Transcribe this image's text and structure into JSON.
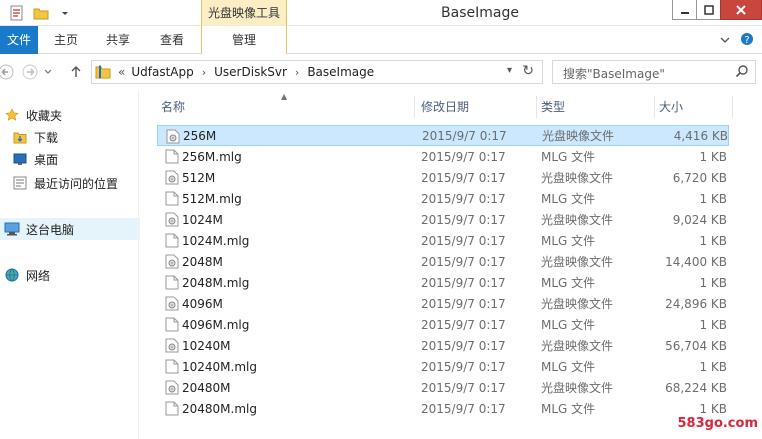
{
  "window": {
    "title": "BaseImage",
    "context_tab_group": "光盘映像工具"
  },
  "ribbon": {
    "tabs": [
      {
        "label": "文件"
      },
      {
        "label": "主页"
      },
      {
        "label": "共享"
      },
      {
        "label": "查看"
      },
      {
        "label": "管理"
      }
    ]
  },
  "address": {
    "overflow": "«",
    "crumbs": [
      "UdfastApp",
      "UserDiskSvr",
      "BaseImage"
    ]
  },
  "search": {
    "placeholder": "搜索\"BaseImage\""
  },
  "navpane": {
    "items": [
      {
        "label": "收藏夹",
        "icon": "star-icon"
      },
      {
        "label": "下载",
        "icon": "downloads-folder-icon"
      },
      {
        "label": "桌面",
        "icon": "desktop-icon"
      },
      {
        "label": "最近访问的位置",
        "icon": "recent-places-icon"
      },
      {
        "label": "这台电脑",
        "icon": "computer-icon"
      },
      {
        "label": "网络",
        "icon": "network-icon"
      }
    ]
  },
  "columns": {
    "name": "名称",
    "date": "修改日期",
    "type": "类型",
    "size": "大小"
  },
  "files": [
    {
      "name": "256M",
      "date": "2015/9/7 0:17",
      "type": "光盘映像文件",
      "size": "4,416 KB",
      "selected": true
    },
    {
      "name": "256M.mlg",
      "date": "2015/9/7 0:17",
      "type": "MLG 文件",
      "size": "1 KB"
    },
    {
      "name": "512M",
      "date": "2015/9/7 0:17",
      "type": "光盘映像文件",
      "size": "6,720 KB"
    },
    {
      "name": "512M.mlg",
      "date": "2015/9/7 0:17",
      "type": "MLG 文件",
      "size": "1 KB"
    },
    {
      "name": "1024M",
      "date": "2015/9/7 0:17",
      "type": "光盘映像文件",
      "size": "9,024 KB"
    },
    {
      "name": "1024M.mlg",
      "date": "2015/9/7 0:17",
      "type": "MLG 文件",
      "size": "1 KB"
    },
    {
      "name": "2048M",
      "date": "2015/9/7 0:17",
      "type": "光盘映像文件",
      "size": "14,400 KB"
    },
    {
      "name": "2048M.mlg",
      "date": "2015/9/7 0:17",
      "type": "MLG 文件",
      "size": "1 KB"
    },
    {
      "name": "4096M",
      "date": "2015/9/7 0:17",
      "type": "光盘映像文件",
      "size": "24,896 KB"
    },
    {
      "name": "4096M.mlg",
      "date": "2015/9/7 0:17",
      "type": "MLG 文件",
      "size": "1 KB"
    },
    {
      "name": "10240M",
      "date": "2015/9/7 0:17",
      "type": "光盘映像文件",
      "size": "56,704 KB"
    },
    {
      "name": "10240M.mlg",
      "date": "2015/9/7 0:17",
      "type": "MLG 文件",
      "size": "1 KB"
    },
    {
      "name": "20480M",
      "date": "2015/9/7 0:17",
      "type": "光盘映像文件",
      "size": "68,224 KB"
    },
    {
      "name": "20480M.mlg",
      "date": "2015/9/7 0:17",
      "type": "MLG 文件",
      "size": "1 KB"
    }
  ],
  "watermark": "583go.com",
  "colors": {
    "accent": "#1979ca",
    "selection": "#cce8ff",
    "context_tab": "#fbeec5"
  }
}
